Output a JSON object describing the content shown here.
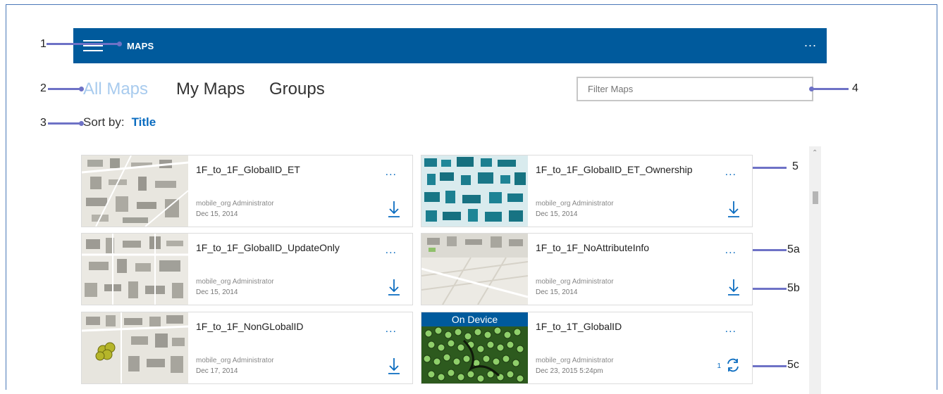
{
  "app": {
    "title": "MAPS",
    "more_label": "..."
  },
  "tabs": [
    {
      "label": "All Maps",
      "active": true
    },
    {
      "label": "My Maps",
      "active": false
    },
    {
      "label": "Groups",
      "active": false
    }
  ],
  "filter": {
    "placeholder": "Filter Maps",
    "value": ""
  },
  "sort": {
    "label": "Sort by:",
    "value": "Title"
  },
  "callouts": {
    "c1": "1",
    "c2": "2",
    "c3": "3",
    "c4": "4",
    "c5": "5",
    "c5a": "5a",
    "c5b": "5b",
    "c5c": "5c"
  },
  "maps": [
    {
      "title": "1F_to_1F_GlobalID_ET",
      "owner": "mobile_org Administrator",
      "date": "Dec 15, 2014",
      "more": "...",
      "action": "download-icon"
    },
    {
      "title": "1F_to_1F_GlobalID_ET_Ownership",
      "owner": "mobile_org Administrator",
      "date": "Dec 15, 2014",
      "more": "...",
      "action": "download-icon"
    },
    {
      "title": "1F_to_1F_GlobalID_UpdateOnly",
      "owner": "mobile_org Administrator",
      "date": "Dec 15, 2014",
      "more": "...",
      "action": "download-icon"
    },
    {
      "title": "1F_to_1F_NoAttributeInfo",
      "owner": "mobile_org Administrator",
      "date": "Dec 15, 2014",
      "more": "...",
      "action": "download-icon"
    },
    {
      "title": "1F_to_1F_NonGLobalID",
      "owner": "mobile_org Administrator",
      "date": "Dec 17, 2014",
      "more": "...",
      "action": "download-icon"
    },
    {
      "title": "1F_to_1T_GlobalID",
      "owner": "mobile_org Administrator",
      "date": "Dec 23, 2015 5:24pm",
      "more": "...",
      "action": "sync-icon",
      "badge": "On Device",
      "sync_count": "1"
    }
  ],
  "colors": {
    "accent": "#005a9c",
    "link": "#0a6cc0",
    "active_tab": "#a8cbee",
    "callout": "#6e72c6"
  }
}
